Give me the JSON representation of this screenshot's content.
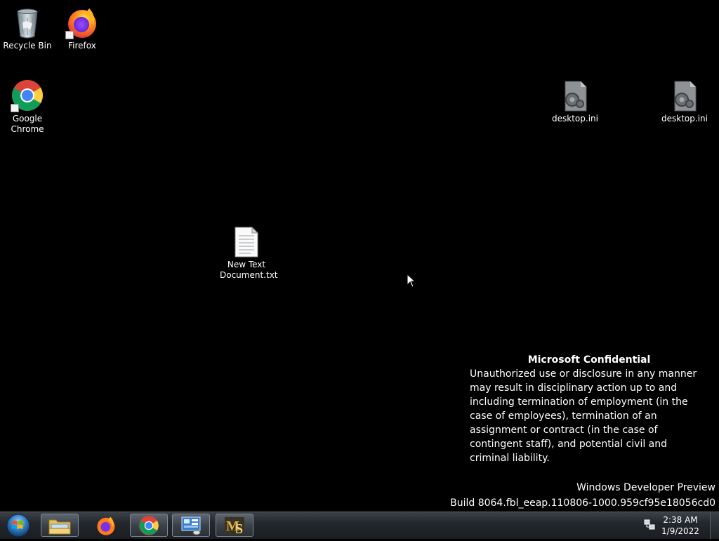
{
  "desktop": {
    "icons": [
      {
        "id": "recycle-bin",
        "label": "Recycle Bin",
        "icon": "recycle-bin-icon"
      },
      {
        "id": "firefox",
        "label": "Firefox",
        "icon": "firefox-icon",
        "shortcut": true
      },
      {
        "id": "google-chrome",
        "label": "Google\nChrome",
        "icon": "chrome-icon",
        "shortcut": true
      },
      {
        "id": "desktop-ini-1",
        "label": "desktop.ini",
        "icon": "settings-file-icon"
      },
      {
        "id": "desktop-ini-2",
        "label": "desktop.ini",
        "icon": "settings-file-icon"
      },
      {
        "id": "new-text-document",
        "label": "New Text\nDocument.txt",
        "icon": "text-file-icon"
      }
    ]
  },
  "watermark": {
    "title": "Microsoft Confidential",
    "body": "Unauthorized use or disclosure in any manner may result in disciplinary action up to and including termination of employment (in the case of employees), termination of an assignment or contract (in the case of contingent staff), and potential civil and criminal liability."
  },
  "build_info": {
    "line1": "Windows Developer Preview",
    "line2": "Build 8064.fbl_eeap.110806-1000.959cf95e18056cd0"
  },
  "taskbar": {
    "start": {
      "icon": "windows-orb-icon"
    },
    "buttons": [
      {
        "id": "explorer",
        "icon": "folder-icon",
        "active": true
      },
      {
        "id": "firefox",
        "icon": "firefox-icon",
        "active": false
      },
      {
        "id": "chrome",
        "icon": "chrome-icon",
        "active": true
      },
      {
        "id": "control-panel",
        "icon": "control-panel-icon",
        "active": true
      },
      {
        "id": "ms-app",
        "icon": "ms-app-icon",
        "active": true
      }
    ],
    "tray": {
      "network_icon": "network-icon",
      "time": "2:38 AM",
      "date": "1/9/2022"
    }
  },
  "colors": {
    "desktop_background": "#000000",
    "taskbar": "#24282d",
    "text": "#ffffff"
  }
}
